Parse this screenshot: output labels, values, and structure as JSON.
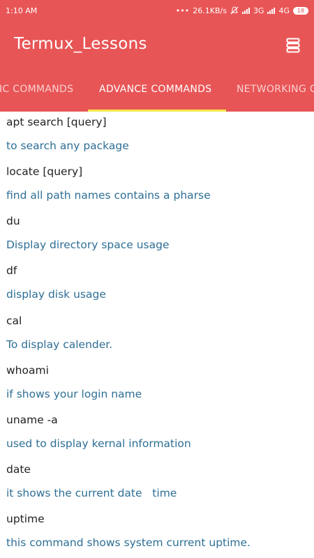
{
  "status_bar": {
    "time": "1:10 AM",
    "speed": "26.1KB/s",
    "network_3g": "3G",
    "network_4g": "4G",
    "battery": "18"
  },
  "app_bar": {
    "title": "Termux_Lessons",
    "menu_icon": "list-stack-icon"
  },
  "tabs": [
    {
      "label": "BASIC COMMANDS",
      "visible_label": "IC COMMANDS",
      "selected": false
    },
    {
      "label": "ADVANCE COMMANDS",
      "selected": true
    },
    {
      "label": "NETWORKING COMMANDS",
      "visible_label": "NETWORKING C",
      "selected": false
    }
  ],
  "colors": {
    "primary": "#e85556",
    "accent": "#f4e84a",
    "description_text": "#2e6f96",
    "command_text": "#222222",
    "background": "#ffffff"
  },
  "commands": [
    {
      "command": "apt search [query]",
      "description": "to search any package"
    },
    {
      "command": "locate [query]",
      "description": "find all path names contains a pharse"
    },
    {
      "command": "du",
      "description": "Display directory space usage"
    },
    {
      "command": "df",
      "description": "display disk usage"
    },
    {
      "command": "cal",
      "description": "To display calender."
    },
    {
      "command": "whoami",
      "description": "if shows your login name"
    },
    {
      "command": "uname -a",
      "description": "used to display kernal information"
    },
    {
      "command": "date",
      "description": "it shows the current date   time"
    },
    {
      "command": "uptime",
      "description": "this command shows system current uptime."
    }
  ]
}
